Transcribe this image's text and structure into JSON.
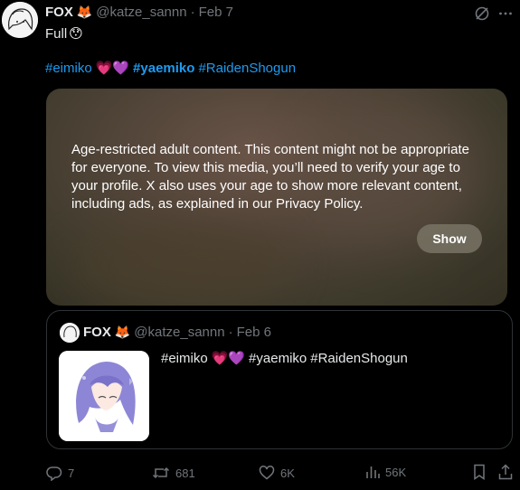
{
  "tweet": {
    "author_name": "FOX",
    "author_emoji": "🦊",
    "handle": "@katze_sannn",
    "separator": "·",
    "date": "Feb 7",
    "text": "Full",
    "text_emoji": "😯",
    "hashtags": [
      {
        "text": "#eimiko",
        "bold": false
      },
      {
        "text": "💗💜",
        "emoji": true
      },
      {
        "text": "#yaemiko",
        "bold": true
      },
      {
        "text": "#RaidenShogun",
        "bold": false
      }
    ]
  },
  "media": {
    "warning": "Age-restricted adult content. This content might not be appropriate for everyone. To view this media, you’ll need to verify your age to your profile. X also uses your age to show more relevant content, including ads, as explained in our Privacy Policy.",
    "show_label": "Show"
  },
  "quote": {
    "author_name": "FOX",
    "author_emoji": "🦊",
    "handle": "@katze_sannn",
    "separator": "·",
    "date": "Feb 6",
    "tag1": "#eimiko",
    "emoji": "💗💜",
    "tag2": "#yaemiko",
    "tag3": "#RaidenShogun"
  },
  "actions": {
    "replies": "7",
    "reposts": "681",
    "likes": "6K",
    "views": "56K"
  },
  "colors": {
    "background": "#000000",
    "text": "#e7e9ea",
    "muted": "#71767b",
    "link": "#1d9bf0",
    "border": "#2f3336"
  }
}
